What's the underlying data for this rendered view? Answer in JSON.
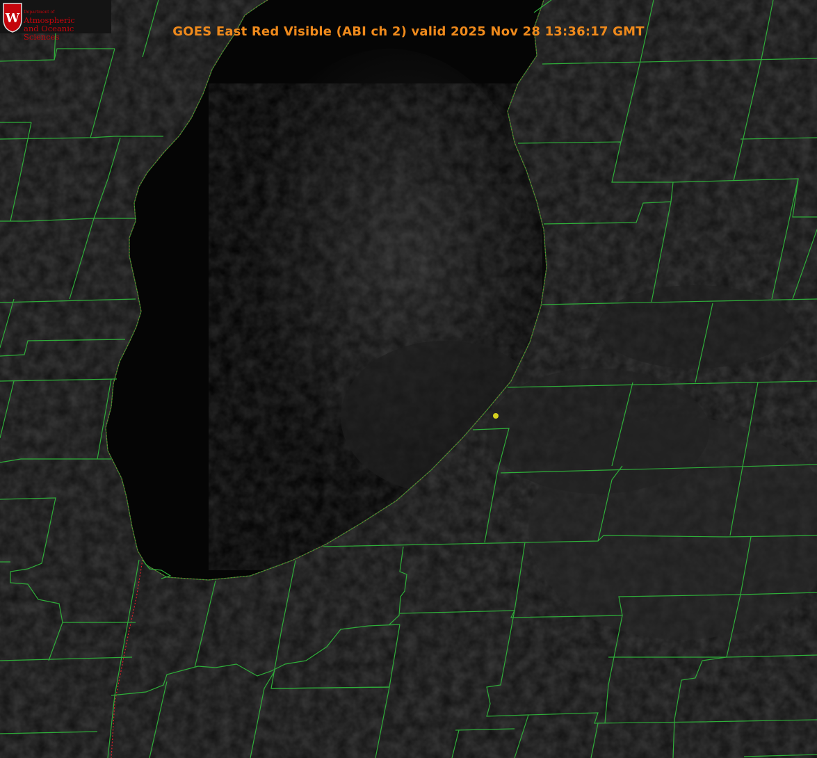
{
  "title": "GOES East Red Visible (ABI ch 2) valid 2025 Nov 28 13:36:17 GMT",
  "logo": {
    "dept": "Department of",
    "line1": "Atmospheric",
    "line2": "and Oceanic Sciences",
    "letter": "W"
  },
  "colors": {
    "title": "#ef8a1c",
    "boundary": "#2fae3a",
    "shoreline": "#e0202a",
    "marker": "#d6d21f",
    "lake": "#050505",
    "land": "#151515",
    "logo": "#c5050c"
  },
  "map": {
    "imagery": "satellite-visible",
    "features": [
      "lake-michigan",
      "county-boundaries",
      "shoreline",
      "station-marker"
    ]
  }
}
